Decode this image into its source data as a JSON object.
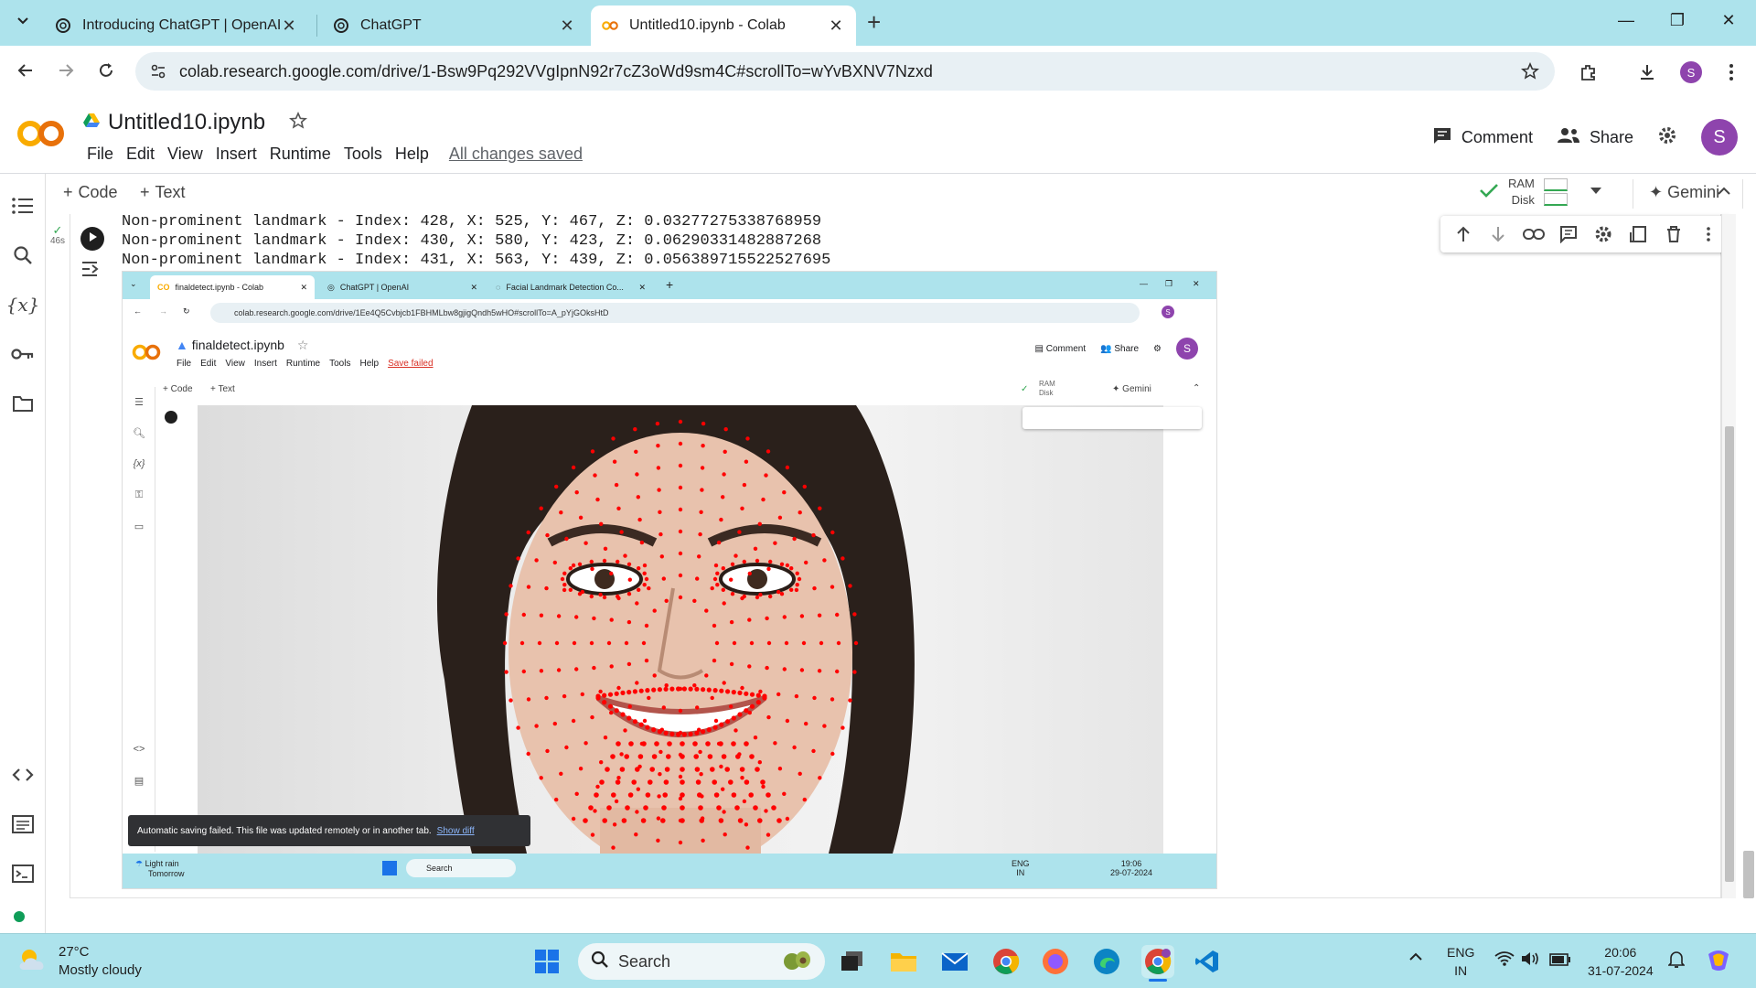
{
  "browser": {
    "tabs": [
      {
        "title": "Introducing ChatGPT | OpenAI",
        "icon": "openai-icon"
      },
      {
        "title": "ChatGPT",
        "icon": "openai-icon"
      },
      {
        "title": "Untitled10.ipynb - Colab",
        "icon": "colab-icon",
        "active": true
      }
    ],
    "url": "colab.research.google.com/drive/1-Bsw9Pq292VVgIpnN92r7cZ3oWd9sm4C#scrollTo=wYvBXNV7Nzxd",
    "profile_initial": "S"
  },
  "colab": {
    "notebook_title": "Untitled10.ipynb",
    "menu": [
      "File",
      "Edit",
      "View",
      "Insert",
      "Runtime",
      "Tools",
      "Help"
    ],
    "save_status": "All changes saved",
    "comment_label": "Comment",
    "share_label": "Share",
    "avatar_initial": "S",
    "add_code": "Code",
    "add_text": "Text",
    "ram_label": "RAM",
    "disk_label": "Disk",
    "gemini_label": "Gemini",
    "exec_time": "46s"
  },
  "output": {
    "lines": [
      "Non-prominent landmark - Index: 428, X: 525, Y: 467, Z: 0.03277275338768959",
      "Non-prominent landmark - Index: 430, X: 580, Y: 423, Z: 0.06290331482887268",
      "Non-prominent landmark - Index: 431, X: 563, Y: 439, Z: 0.056389715522527695"
    ]
  },
  "embedded": {
    "tabs": [
      {
        "title": "finaldetect.ipynb - Colab"
      },
      {
        "title": "ChatGPT | OpenAI"
      },
      {
        "title": "Facial Landmark Detection Co..."
      }
    ],
    "url": "colab.research.google.com/drive/1Ee4Q5Cvbjcb1FBHMLbw8gjigQndh5wHO#scrollTo=A_pYjGOksHtD",
    "notebook_title": "finaldetect.ipynb",
    "menu": [
      "File",
      "Edit",
      "View",
      "Insert",
      "Runtime",
      "Tools",
      "Help"
    ],
    "save_status": "Save failed",
    "comment_label": "Comment",
    "share_label": "Share",
    "avatar_initial": "S",
    "add_code": "Code",
    "add_text": "Text",
    "ram_label": "RAM",
    "disk_label": "Disk",
    "gemini_label": "Gemini",
    "toast_text": "Automatic saving failed. This file was updated remotely or in another tab.",
    "toast_link": "Show diff",
    "weather_line1": "Light rain",
    "weather_line2": "Tomorrow",
    "search_label": "Search",
    "lang_line1": "ENG",
    "lang_line2": "IN",
    "time": "19:06",
    "date": "29-07-2024"
  },
  "taskbar": {
    "temperature": "27°C",
    "weather": "Mostly cloudy",
    "search_label": "Search",
    "lang_line1": "ENG",
    "lang_line2": "IN",
    "time": "20:06",
    "date": "31-07-2024"
  },
  "colors": {
    "chrome_bg": "#ade3ec",
    "colab_orange": "#f9ab00",
    "landmark_red": "#ff0000",
    "avatar_purple": "#8e44ad"
  }
}
